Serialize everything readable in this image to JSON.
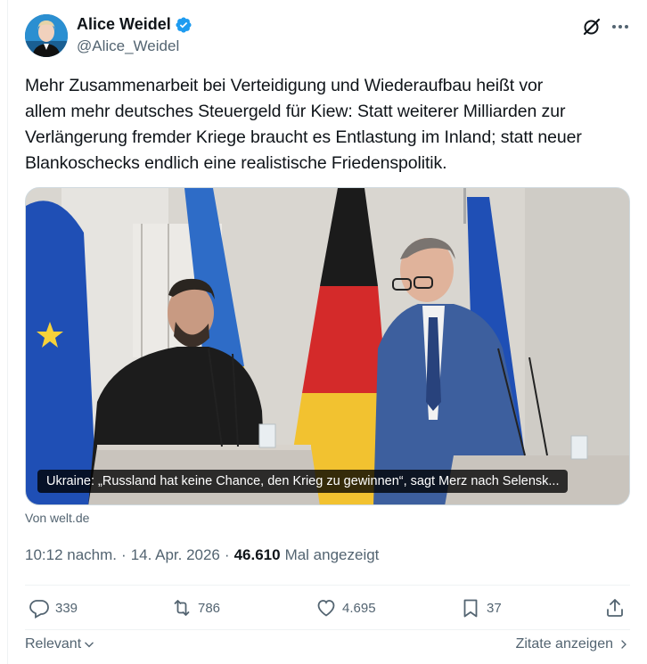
{
  "author": {
    "name": "Alice Weidel",
    "handle": "@Alice_Weidel",
    "verified": true
  },
  "header_icons": [
    "grok-icon",
    "more-icon"
  ],
  "tweet": {
    "line1": "Mehr Zusammenarbeit bei Verteidigung und Wiederaufbau heißt vor",
    "line2": "allem mehr deutsches Steuergeld für Kiew: Statt weiterer Milliarden zur",
    "line3": "Verlängerung fremder Kriege braucht es Entlastung im Inland; statt neuer",
    "line4": "Blankoschecks endlich eine realistische Friedenspolitik."
  },
  "media": {
    "caption": "Ukraine: „Russland hat keine Chance, den Krieg zu gewinnen“, sagt Merz nach Selensk...",
    "source": "Von welt.de"
  },
  "meta": {
    "time": "10:12 nachm.",
    "sep1": "·",
    "date": "14. Apr. 2026",
    "sep2": "·",
    "views": "46.610",
    "views_label": "Mal angezeigt"
  },
  "actions": {
    "replies": "339",
    "reposts": "786",
    "likes": "4.695",
    "bookmarks": "37"
  },
  "footer": {
    "sort_label": "Relevant",
    "quotes_label": "Zitate anzeigen"
  },
  "colors": {
    "text": "#0f1419",
    "secondary": "#536471",
    "verified_blue": "#1d9bf0",
    "border": "#eff3f4"
  }
}
